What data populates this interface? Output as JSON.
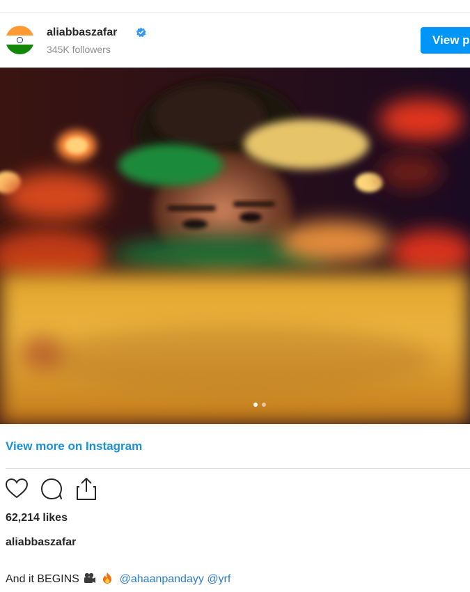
{
  "post": {
    "username": "aliabbaszafar",
    "followers": "345K followers",
    "view_profile_label": "View profile",
    "verified_icon": "verified-badge-icon",
    "avatar_colors": [
      "#ff9933",
      "#ffffff",
      "#138808"
    ],
    "image": {
      "carousel_count": 2,
      "active_index": 1
    },
    "view_more_label": "View more on Instagram",
    "likes": "62,214 likes",
    "author": "aliabbaszafar",
    "caption": {
      "text": "And it BEGINS",
      "emoji": [
        "movie-camera-icon",
        "fire-icon"
      ],
      "mentions": [
        "@ahaanpandayy",
        "@yrf"
      ]
    },
    "action_icons": [
      "heart-icon",
      "comment-icon",
      "share-icon"
    ],
    "colors": {
      "accent": "#0095f6",
      "link": "#1a8fd6",
      "muted": "#8e8e8e"
    }
  }
}
